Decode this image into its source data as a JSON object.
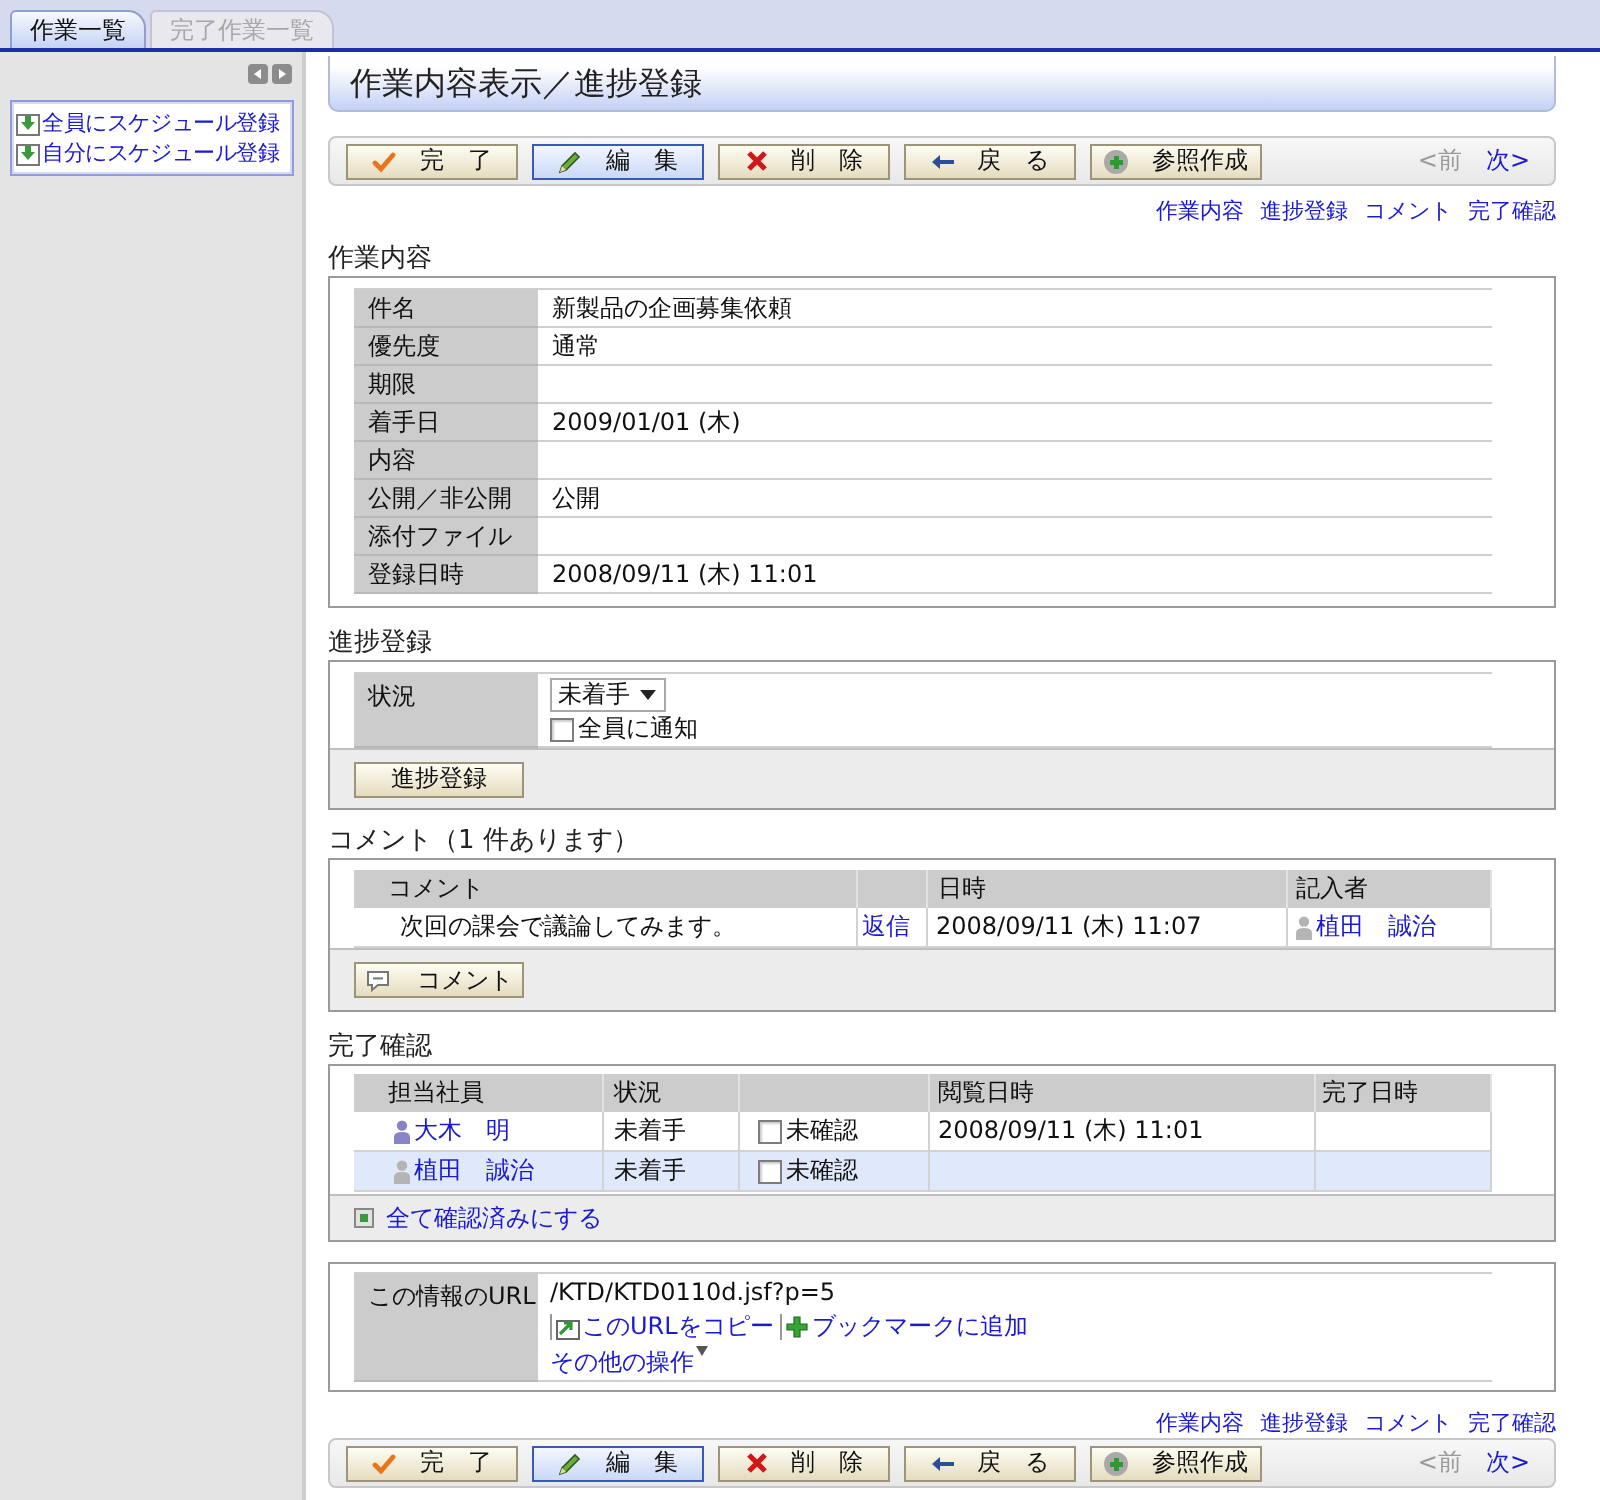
{
  "tabs": [
    {
      "label": "作業一覧",
      "selected": true
    },
    {
      "label": "完了作業一覧",
      "selected": false
    }
  ],
  "sidebar": {
    "links": [
      "全員にスケジュール登録",
      "自分にスケジュール登録"
    ]
  },
  "header": {
    "title": "作業内容表示／進捗登録"
  },
  "top_toolbar": {
    "buttons": [
      {
        "kind": "done",
        "label": "完 了",
        "focused": false
      },
      {
        "kind": "edit",
        "label": "編 集",
        "focused": true
      },
      {
        "kind": "delete",
        "label": "削 除",
        "focused": false
      },
      {
        "kind": "back",
        "label": "戻 る",
        "focused": false
      },
      {
        "kind": "copy",
        "label": "参照作成",
        "focused": false
      }
    ],
    "pager": [
      {
        "label": "<前",
        "disabled": true
      },
      {
        "label": "次>",
        "disabled": false
      }
    ]
  },
  "top_links": [
    "作業内容",
    "進捗登録",
    "コメント",
    "完了確認"
  ],
  "work_content": {
    "title": "作業内容",
    "rows": [
      {
        "label": "件名",
        "value": "新製品の企画募集依頼"
      },
      {
        "label": "優先度",
        "value": "通常"
      },
      {
        "label": "期限"
      },
      {
        "label": "着手日",
        "value": "2009/01/01 (木)"
      },
      {
        "label": "内容"
      },
      {
        "label": "公開／非公開",
        "value": "公開"
      },
      {
        "label": "添付ファイル"
      },
      {
        "label": "登録日時",
        "value": "2008/09/11 (木) 11:01"
      }
    ]
  },
  "progress": {
    "title": "進捗登録",
    "label": "状況",
    "status": {
      "value": "未着手"
    },
    "notify": {
      "label": "全員に通知",
      "checked": false
    },
    "button": "進捗登録"
  },
  "comments": {
    "title": "コメント（1 件あります）",
    "columns": [
      "コメント",
      "日時",
      "記入者"
    ],
    "rows": [
      {
        "comment": "次回の課会で議論してみます。",
        "reply": "返信",
        "date": "2008/09/11 (木) 11:07",
        "author": "植田　誠治",
        "color": "#b4b4b4"
      }
    ],
    "button": "コメント"
  },
  "completion": {
    "title": "完了確認",
    "columns": [
      "担当社員",
      "状況",
      "閲覧日時",
      "完了日時"
    ],
    "rows": [
      {
        "name": "大木　明",
        "color": "#8a84c4",
        "status": "未着手",
        "confirm": {
          "label": "未確認",
          "checked": false
        },
        "viewed": "2008/09/11 (木) 11:01",
        "selected": false
      },
      {
        "name": "植田　誠治",
        "color": "#b4b4b4",
        "status": "未着手",
        "confirm": {
          "label": "未確認",
          "checked": false
        },
        "selected": true
      }
    ],
    "action": "全て確認済みにする"
  },
  "url_info": {
    "label": "この情報のURL",
    "url": "/KTD/KTD0110d.jsf?p=5",
    "links": [
      "このURLをコピー",
      "ブックマークに追加"
    ],
    "more": "その他の操作"
  },
  "bottom_links": [
    "作業内容",
    "進捗登録",
    "コメント",
    "完了確認"
  ],
  "bottom_toolbar": {
    "buttons": [
      {
        "kind": "done",
        "label": "完 了",
        "focused": false
      },
      {
        "kind": "edit",
        "label": "編 集",
        "focused": true
      },
      {
        "kind": "delete",
        "label": "削 除",
        "focused": false
      },
      {
        "kind": "back",
        "label": "戻 る",
        "focused": false
      },
      {
        "kind": "copy",
        "label": "参照作成",
        "focused": false
      }
    ],
    "pager": [
      {
        "label": "<前",
        "disabled": true
      },
      {
        "label": "次>",
        "disabled": false
      }
    ]
  }
}
